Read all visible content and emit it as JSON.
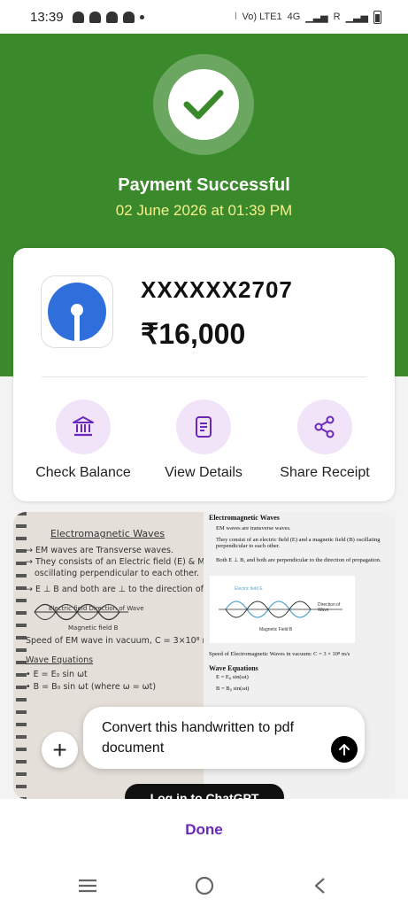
{
  "status_bar": {
    "time": "13:39",
    "network": "4G",
    "roaming": "R",
    "volte": "Vo) LTE1"
  },
  "payment": {
    "title": "Payment Successful",
    "datetime": "02 June 2026 at 01:39 PM",
    "account": "XXXXXX2707",
    "amount": "₹16,000"
  },
  "actions": [
    {
      "label": "Check Balance",
      "icon": "bank-icon"
    },
    {
      "label": "View Details",
      "icon": "document-icon"
    },
    {
      "label": "Share Receipt",
      "icon": "share-icon"
    }
  ],
  "notebook": {
    "heading": "Electromagnetic Waves",
    "lines": [
      "→ EM waves are Transverse waves.",
      "→ They consists of an Electric field (E) & Magnetic field (B)",
      "oscillating perpendicular to each other.",
      "→ E ⊥ B and both are ⊥ to the direction of propagation",
      "Electric field      Direction of Wave",
      "Magnetic field B",
      "Speed of EM wave in vacuum,  C = 3×10⁸ m/s",
      "Wave Equations",
      "• E = E₀ sin ωt",
      "• B = B₀ sin ωt     (where ω = ωt)"
    ]
  },
  "doc": {
    "heading": "Electromagnetic Waves",
    "b1": "EM waves are transverse waves.",
    "b2": "They consist of an electric field (E) and a magnetic field (B) oscillating perpendicular to each other.",
    "b3": "Both E ⊥ B, and both are perpendicular to the direction of propagation.",
    "fig_e": "Electric field E",
    "fig_b": "Magnetic Field B",
    "fig_dir": "Direction of Wave",
    "speed": "Speed of Electromagnetic Waves in vacuum:  C = 3 × 10⁸ m/s",
    "eq_heading": "Wave Equations",
    "eq1": "E = E₀ sin(ωt)",
    "eq2": "B = B₀ sin(ωt)"
  },
  "chatgpt": {
    "prompt": "Convert this handwritten to pdf document",
    "login": "Log in to ChatGPT"
  },
  "footer": {
    "done": "Done"
  },
  "colors": {
    "success_green": "#3a8a2c",
    "accent_purple": "#6a28b8",
    "bank_blue": "#2f6fdc"
  }
}
